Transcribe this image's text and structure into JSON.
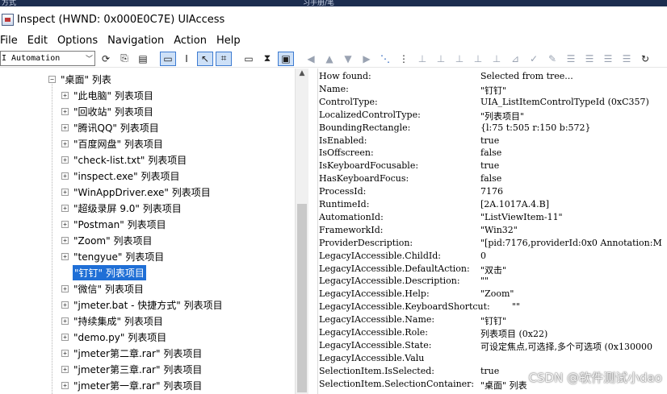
{
  "top_strip": {
    "left": "方式",
    "middle": "习手册/笔"
  },
  "window": {
    "title": "Inspect (HWND: 0x000E0C7E) UIAccess"
  },
  "menu": [
    "File",
    "Edit",
    "Options",
    "Navigation",
    "Action",
    "Help"
  ],
  "toolbar": {
    "mode": "I Automation",
    "buttons": [
      {
        "icon": "refresh-icon",
        "glyph": "⟳"
      },
      {
        "icon": "copy-icon",
        "glyph": "⎘"
      },
      {
        "icon": "properties-icon",
        "glyph": "▤"
      },
      {
        "icon": "watch-focus-icon",
        "glyph": "▭",
        "state": "selected"
      },
      {
        "icon": "text-cursor-icon",
        "glyph": "Ι"
      },
      {
        "icon": "watch-cursor-icon",
        "glyph": "↖",
        "state": "selected"
      },
      {
        "icon": "show-highlight-icon",
        "glyph": "⌗",
        "state": "selected"
      },
      {
        "icon": "rectangle-icon",
        "glyph": "▭"
      },
      {
        "icon": "hourglass-icon",
        "glyph": "⧗"
      },
      {
        "icon": "caret-tracking-icon",
        "glyph": "▣",
        "state": "selected"
      },
      {
        "icon": "nav-back-icon",
        "glyph": "◀",
        "state": "disabled"
      },
      {
        "icon": "nav-up-icon",
        "glyph": "▲",
        "state": "disabled"
      },
      {
        "icon": "nav-down-icon",
        "glyph": "▼",
        "state": "disabled"
      },
      {
        "icon": "nav-forward-icon",
        "glyph": "▶",
        "state": "disabled"
      },
      {
        "icon": "tree-view-icon",
        "glyph": "⋱",
        "state": "highlight"
      },
      {
        "icon": "vertical-dots-icon",
        "glyph": "⋮"
      },
      {
        "icon": "parent-icon",
        "glyph": "⊥",
        "state": "disabled"
      },
      {
        "icon": "first-child-icon",
        "glyph": "⊥",
        "state": "disabled"
      },
      {
        "icon": "next-sibling-icon",
        "glyph": "⊥",
        "state": "disabled"
      },
      {
        "icon": "prev-sibling-icon",
        "glyph": "⊥",
        "state": "disabled"
      },
      {
        "icon": "last-child-icon",
        "glyph": "⊥",
        "state": "disabled"
      },
      {
        "icon": "pattern-icon",
        "glyph": "⊿",
        "state": "disabled"
      },
      {
        "icon": "check-icon",
        "glyph": "✓",
        "state": "disabled"
      },
      {
        "icon": "edit-icon",
        "glyph": "✎",
        "state": "disabled"
      },
      {
        "icon": "list-icon",
        "glyph": "☰",
        "state": "disabled"
      },
      {
        "icon": "list-alt-icon",
        "glyph": "☰",
        "state": "disabled"
      },
      {
        "icon": "list-more-icon",
        "glyph": "☰",
        "state": "disabled"
      },
      {
        "icon": "list-end-icon",
        "glyph": "☰",
        "state": "disabled"
      },
      {
        "icon": "reload-icon",
        "glyph": "↻"
      }
    ]
  },
  "tree": {
    "parent": "\"桌面\" 列表",
    "items": [
      {
        "label": "\"此电脑\" 列表项目"
      },
      {
        "label": "\"回收站\" 列表项目"
      },
      {
        "label": "\"腾讯QQ\" 列表项目"
      },
      {
        "label": "\"百度网盘\" 列表项目"
      },
      {
        "label": "\"check-list.txt\" 列表项目"
      },
      {
        "label": "\"inspect.exe\" 列表项目"
      },
      {
        "label": "\"WinAppDriver.exe\" 列表项目"
      },
      {
        "label": "\"超级录屏 9.0\" 列表项目"
      },
      {
        "label": "\"Postman\" 列表项目"
      },
      {
        "label": "\"Zoom\" 列表项目"
      },
      {
        "label": "\"tengyue\" 列表项目"
      },
      {
        "label": "\"钉钉\" 列表项目",
        "selected": true
      },
      {
        "label": "\"微信\" 列表项目"
      },
      {
        "label": "\"jmeter.bat - 快捷方式\" 列表项目"
      },
      {
        "label": "\"持续集成\" 列表项目"
      },
      {
        "label": "\"demo.py\" 列表项目"
      },
      {
        "label": "\"jmeter第二章.rar\" 列表项目"
      },
      {
        "label": "\"jmeter第三章.rar\" 列表项目"
      },
      {
        "label": "\"jmeter第一章.rar\" 列表项目"
      }
    ]
  },
  "properties": [
    {
      "name": "How found:",
      "value": "Selected from tree..."
    },
    {
      "name": "Name:",
      "value": "\"钉钉\""
    },
    {
      "name": "ControlType:",
      "value": "UIA_ListItemControlTypeId (0xC357)"
    },
    {
      "name": "LocalizedControlType:",
      "value": "\"列表项目\""
    },
    {
      "name": "BoundingRectangle:",
      "value": "{l:75 t:505 r:150 b:572}"
    },
    {
      "name": "IsEnabled:",
      "value": "true"
    },
    {
      "name": "IsOffscreen:",
      "value": "false"
    },
    {
      "name": "IsKeyboardFocusable:",
      "value": "true"
    },
    {
      "name": "HasKeyboardFocus:",
      "value": "false"
    },
    {
      "name": "ProcessId:",
      "value": "7176"
    },
    {
      "name": "RuntimeId:",
      "value": "[2A.1017A.4.B]"
    },
    {
      "name": "AutomationId:",
      "value": "\"ListViewItem-11\""
    },
    {
      "name": "FrameworkId:",
      "value": "\"Win32\""
    },
    {
      "name": "ProviderDescription:",
      "value": "\"[pid:7176,providerId:0x0 Annotation:M"
    },
    {
      "name": "LegacyIAccessible.ChildId:",
      "value": "0"
    },
    {
      "name": "LegacyIAccessible.DefaultAction:",
      "value": "\"双击\""
    },
    {
      "name": "LegacyIAccessible.Description:",
      "value": "\"\""
    },
    {
      "name": "LegacyIAccessible.Help:",
      "value": "\"Zoom\""
    },
    {
      "name": "LegacyIAccessible.KeyboardShortcut:",
      "value": "\"\""
    },
    {
      "name": "LegacyIAccessible.Name:",
      "value": "\"钉钉\""
    },
    {
      "name": "LegacyIAccessible.Role:",
      "value": "列表项目 (0x22)"
    },
    {
      "name": "LegacyIAccessible.State:",
      "value": "可设定焦点,可选择,多个可选项 (0x130000"
    },
    {
      "name": "LegacyIAccessible.Valu",
      "value": ""
    },
    {
      "name": "SelectionItem.IsSelected:",
      "value": "true"
    },
    {
      "name": "SelectionItem.SelectionContainer:",
      "value": "\"桌面\" 列表"
    }
  ],
  "watermark": "CSDN @软件测试小dao"
}
